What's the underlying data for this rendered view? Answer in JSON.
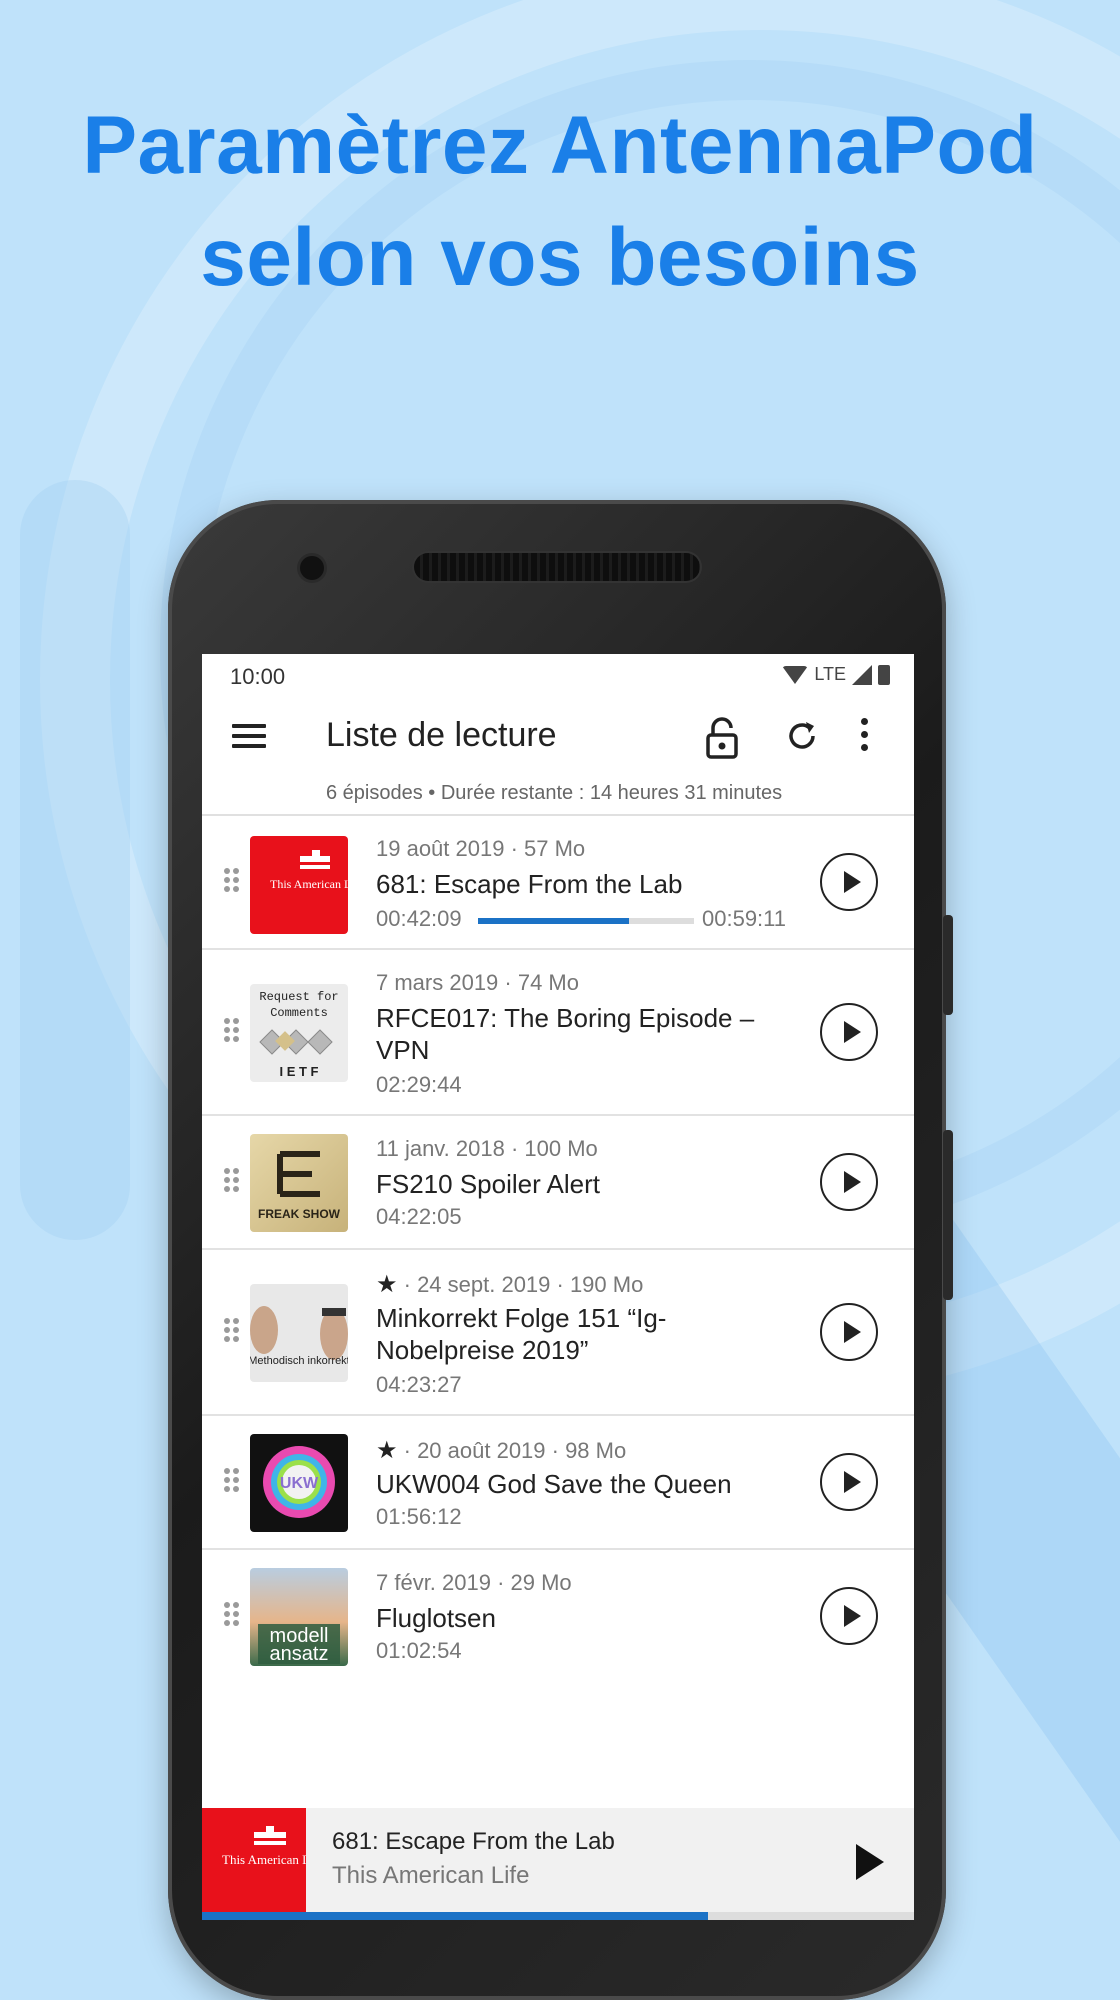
{
  "headline": {
    "line1": "Paramètrez AntennaPod",
    "line2": "selon vos besoins"
  },
  "status": {
    "time": "10:00",
    "network": "LTE"
  },
  "toolbar": {
    "title": "Liste de lecture"
  },
  "summary": "6 épisodes • Durée restante : 14 heures 31 minutes",
  "episodes": [
    {
      "meta": "19 août 2019 · 57 Mo",
      "title": "681: Escape From the Lab",
      "position": "00:42:09",
      "remaining": "00:59:11",
      "progress": 0.7,
      "cover_text": "This American Life"
    },
    {
      "meta": "7 mars 2019 · 74 Mo",
      "title": "RFCE017: The Boring Episode – VPN",
      "duration": "02:29:44",
      "cover_text_1": "Request for",
      "cover_text_2": "Comments",
      "cover_text_3": "I E T F"
    },
    {
      "meta": "11 janv. 2018 · 100 Mo",
      "title": "FS210 Spoiler Alert",
      "duration": "04:22:05",
      "cover_text": "FREAK SHOW"
    },
    {
      "meta": " · 24 sept. 2019 · 190 Mo",
      "title": "Minkorrekt Folge 151 “Ig-Nobelpreise 2019”",
      "duration": "04:23:27",
      "cover_text": "Methodisch inkorrekt"
    },
    {
      "meta": " · 20 août 2019 · 98 Mo",
      "title": "UKW004 God Save the Queen",
      "duration": "01:56:12",
      "cover_text": "UKW"
    },
    {
      "meta": "7 févr. 2019 · 29 Mo",
      "title": "Fluglotsen",
      "duration": "01:02:54",
      "cover_text_1": "modell",
      "cover_text_2": "ansatz"
    }
  ],
  "player": {
    "title": "681: Escape From the Lab",
    "podcast": "This American Life",
    "progress": 0.71
  }
}
